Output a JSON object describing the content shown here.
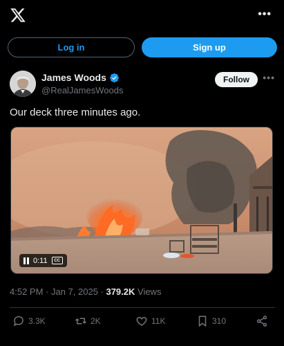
{
  "header": {
    "logo_icon": "x-logo-icon",
    "more_icon": "more-horizontal-icon",
    "more_label": "•••"
  },
  "auth": {
    "login_label": "Log in",
    "signup_label": "Sign up"
  },
  "post": {
    "author": {
      "name": "James Woods",
      "handle": "@RealJamesWoods",
      "verified": true,
      "avatar_icon": "avatar-photo"
    },
    "follow_label": "Follow",
    "more_label": "•••",
    "text": "Our deck three minutes ago.",
    "media": {
      "type": "video",
      "elapsed": "0:11",
      "cc_label": "CC",
      "playing": true
    },
    "timestamp": "4:52 PM · Jan 7, 2025 · ",
    "views_count": "379.2K",
    "views_label": " Views",
    "stats": {
      "replies": "3.3K",
      "reposts": "2K",
      "likes": "11K",
      "bookmarks": "310"
    }
  },
  "colors": {
    "accent": "#1d9bf0",
    "background": "#000000",
    "muted": "#71767b",
    "text": "#e7e9ea"
  }
}
